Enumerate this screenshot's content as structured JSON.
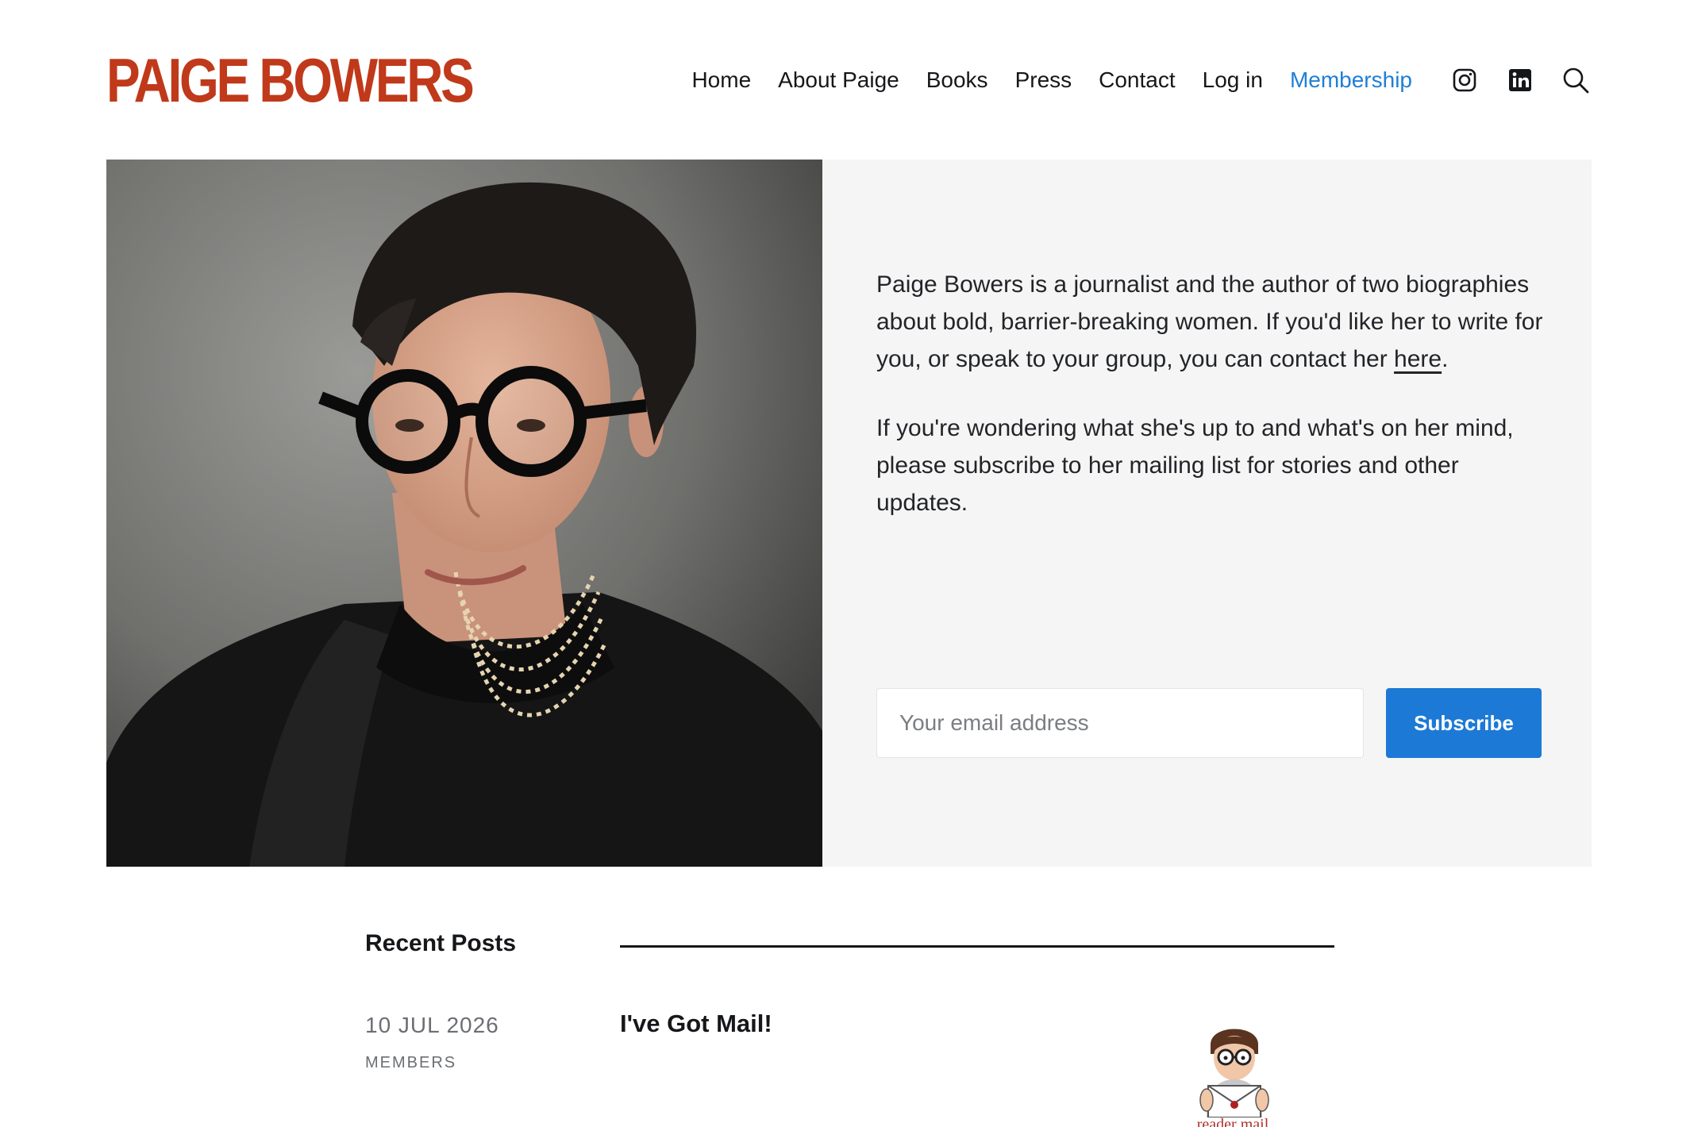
{
  "site": {
    "logo": "PAIGE BOWERS",
    "logo_color": "#c0391a",
    "accent_color": "#1f7fd6"
  },
  "nav": {
    "items": [
      {
        "label": "Home"
      },
      {
        "label": "About Paige"
      },
      {
        "label": "Books"
      },
      {
        "label": "Press"
      },
      {
        "label": "Contact"
      },
      {
        "label": "Log in"
      },
      {
        "label": "Membership"
      }
    ],
    "icons": [
      "instagram-icon",
      "linkedin-icon",
      "search-icon"
    ]
  },
  "hero": {
    "paragraph1_before": "Paige Bowers is a journalist and the author of two biographies about bold, barrier-breaking women. If you'd like her to write for you, or speak to your group, you can contact her ",
    "paragraph1_link": "here",
    "paragraph1_after": ".",
    "paragraph2": "If you're wondering what she's up to and what's on her mind, please subscribe to her mailing list for stories and other updates.",
    "email_placeholder": "Your email address",
    "subscribe_label": "Subscribe",
    "button_color": "#1c79d6"
  },
  "recent_posts": {
    "title": "Recent Posts",
    "posts": [
      {
        "date": "10 JUL 2026",
        "tag": "MEMBERS",
        "title": "I've Got Mail!",
        "thumb_caption": "reader mail"
      }
    ]
  }
}
